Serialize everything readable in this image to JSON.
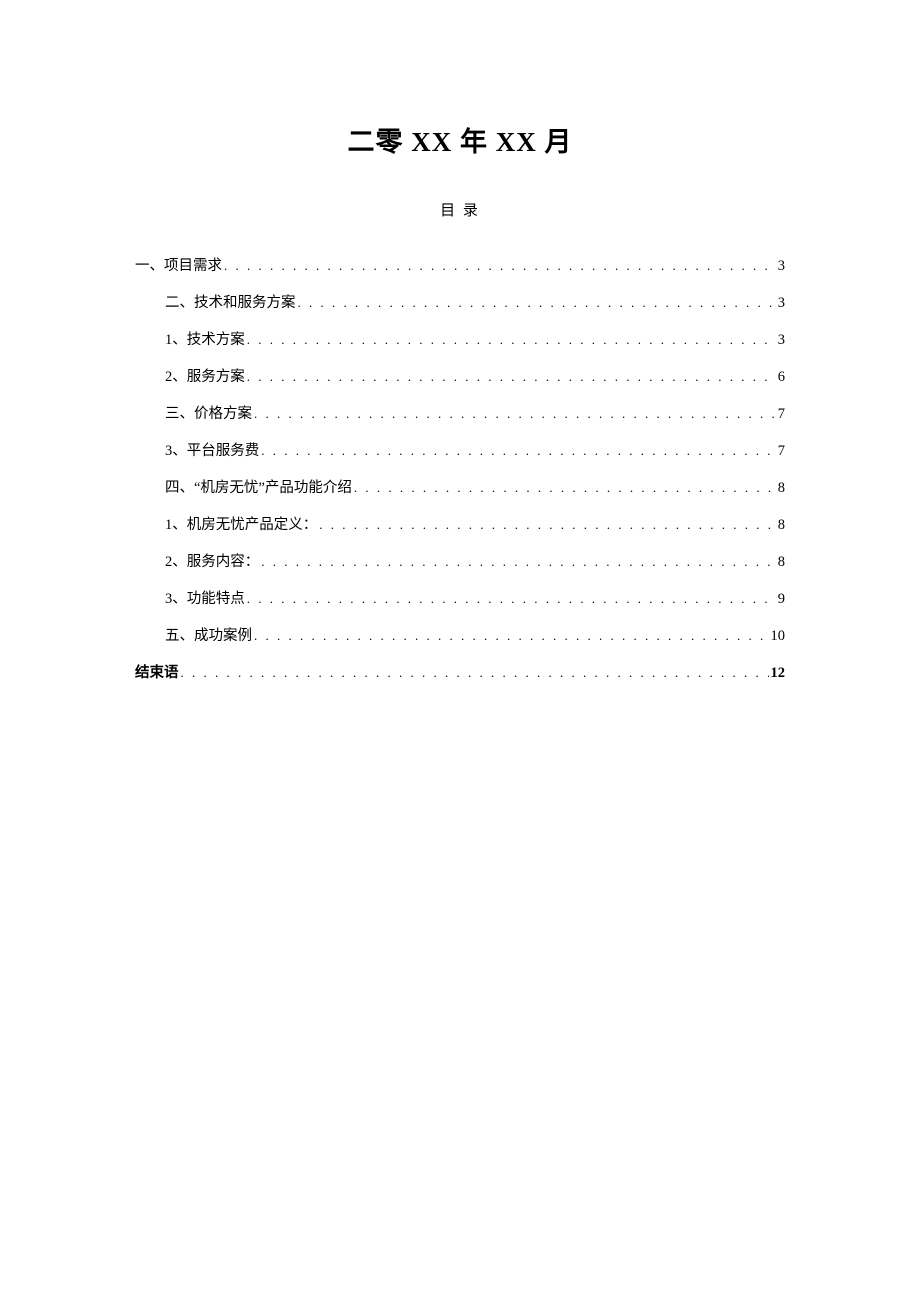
{
  "title": "二零 XX 年 XX 月",
  "subtitle": "目 录",
  "toc": [
    {
      "level": 1,
      "text": "一、项目需求",
      "page": "3",
      "bold": false
    },
    {
      "level": 2,
      "text": "二、技术和服务方案",
      "page": "3",
      "bold": false
    },
    {
      "level": 2,
      "text": "1、技术方案",
      "page": "3",
      "bold": false
    },
    {
      "level": 2,
      "text": "2、服务方案",
      "page": "6",
      "bold": false
    },
    {
      "level": 2,
      "text": "三、价格方案",
      "page": "7",
      "bold": false
    },
    {
      "level": 2,
      "text": "3、平台服务费",
      "page": "7",
      "bold": false
    },
    {
      "level": 2,
      "text": "四、“机房无忧”产品功能介绍",
      "page": "8",
      "bold": false
    },
    {
      "level": 2,
      "text": "1、机房无忧产品定义：",
      "page": "8",
      "bold": false
    },
    {
      "level": 2,
      "text": "2、服务内容：",
      "page": "8",
      "bold": false
    },
    {
      "level": 2,
      "text": "3、功能特点",
      "page": "9",
      "bold": false
    },
    {
      "level": 2,
      "text": "五、成功案例",
      "page": "10",
      "bold": false
    },
    {
      "level": 1,
      "text": "结束语",
      "page": "12",
      "bold": true
    }
  ],
  "dots": ". . . . . . . . . . . . . . . . . . . . . . . . . . . . . . . . . . . . . . . . . . . . . . . . . . . . . . . . . . . . . . . . . . . . . . . . . . . . . . . . . . . . . . . . . . . . . . . . . . . . . . . . . . . . . . . . . . . . . . . ."
}
